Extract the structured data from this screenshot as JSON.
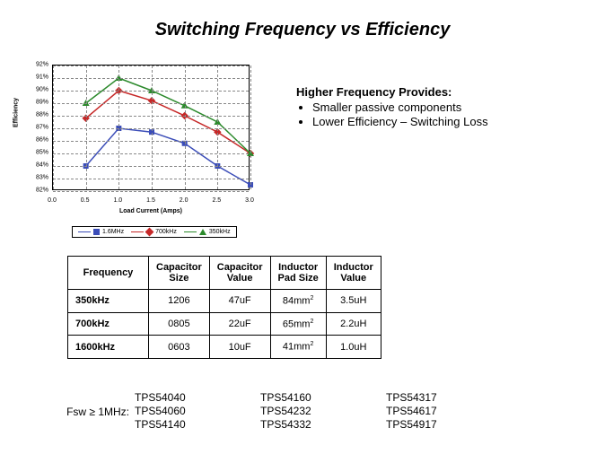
{
  "title": "Switching Frequency vs Efficiency",
  "chart_data": {
    "type": "line",
    "xlabel": "Load Current (Amps)",
    "ylabel": "Efficiency",
    "x": [
      0.5,
      1.0,
      1.5,
      2.0,
      2.5,
      3.0
    ],
    "xticks": [
      0.0,
      0.5,
      1.0,
      1.5,
      2.0,
      2.5,
      3.0
    ],
    "yticks": [
      82,
      83,
      84,
      85,
      86,
      87,
      88,
      89,
      90,
      91,
      92
    ],
    "xlim": [
      0.0,
      3.0
    ],
    "ylim": [
      82,
      92
    ],
    "series": [
      {
        "name": "1.6MHz",
        "color": "#3b4db8",
        "marker": "square",
        "values": [
          84.0,
          87.0,
          86.7,
          85.8,
          84.0,
          82.5
        ]
      },
      {
        "name": "700kHz",
        "color": "#c62828",
        "marker": "diamond",
        "values": [
          87.8,
          90.0,
          89.2,
          88.0,
          86.7,
          85.0
        ]
      },
      {
        "name": "350kHz",
        "color": "#2c8a2c",
        "marker": "triangle",
        "values": [
          89.0,
          91.0,
          90.0,
          88.8,
          87.5,
          85.0
        ]
      }
    ]
  },
  "side": {
    "heading": "Higher Frequency Provides:",
    "bullets": [
      "Smaller passive components",
      "Lower Efficiency – Switching Loss"
    ]
  },
  "table": {
    "headers": [
      "Frequency",
      "Capacitor Size",
      "Capacitor Value",
      "Inductor Pad Size",
      "Inductor Value"
    ],
    "rows": [
      {
        "freq": "350kHz",
        "capSize": "1206",
        "capVal": "47uF",
        "indPad": "84mm",
        "indPadSup": "2",
        "indVal": "3.5uH"
      },
      {
        "freq": "700kHz",
        "capSize": "0805",
        "capVal": "22uF",
        "indPad": "65mm",
        "indPadSup": "2",
        "indVal": "2.2uH"
      },
      {
        "freq": "1600kHz",
        "capSize": "0603",
        "capVal": "10uF",
        "indPad": "41mm",
        "indPadSup": "2",
        "indVal": "1.0uH"
      }
    ]
  },
  "parts": {
    "prefix": "Fsw ≥ 1MHz:",
    "cols": [
      [
        "TPS54040",
        "TPS54060",
        "TPS54140"
      ],
      [
        "TPS54160",
        "TPS54232",
        "TPS54332"
      ],
      [
        "TPS54317",
        "TPS54617",
        "TPS54917"
      ]
    ]
  }
}
